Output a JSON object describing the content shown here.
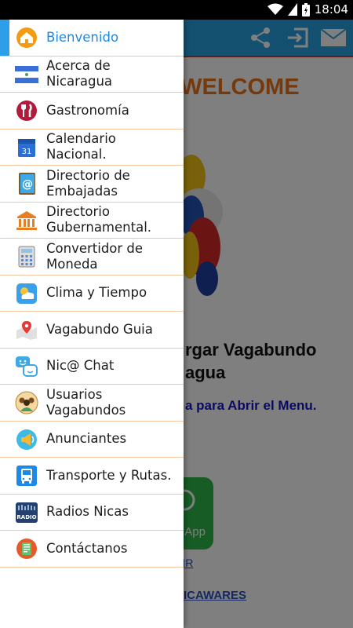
{
  "status_bar": {
    "time": "18:04"
  },
  "app": {
    "welcome_text": "/ WELCOME",
    "heading_line1": "rgar Vagabundo",
    "heading_line2": "agua",
    "menu_hint": "a para Abrir el Menu.",
    "whatsapp_label": "App",
    "share_link": "RTIR",
    "credit_prefix": "- ",
    "credit_link": "NICAWARES"
  },
  "colors": {
    "toolbar": "#29a3e0",
    "accent": "#e8731a",
    "selected": "#1e88e5",
    "divider": "#f3c7a0"
  },
  "drawer": {
    "items": [
      {
        "label": "Bienvenido",
        "icon": "home-icon",
        "selected": true
      },
      {
        "label": "Acerca de Nicaragua",
        "icon": "nicaragua-flag-icon",
        "selected": false
      },
      {
        "label": "Gastronomía",
        "icon": "fork-knife-icon",
        "selected": false
      },
      {
        "label": "Calendario Nacional.",
        "icon": "calendar-icon",
        "calendar_day": "31",
        "selected": false
      },
      {
        "label": "Directorio de Embajadas",
        "icon": "contacts-book-icon",
        "selected": false
      },
      {
        "label": "Directorio Gubernamental.",
        "icon": "government-building-icon",
        "selected": false
      },
      {
        "label": "Convertidor de Moneda",
        "icon": "calculator-icon",
        "selected": false
      },
      {
        "label": "Clima y Tiempo",
        "icon": "weather-icon",
        "selected": false
      },
      {
        "label": "Vagabundo Guia",
        "icon": "map-pin-icon",
        "selected": false
      },
      {
        "label": "Nic@ Chat",
        "icon": "chat-bubbles-icon",
        "selected": false
      },
      {
        "label": "Usuarios Vagabundos",
        "icon": "users-group-icon",
        "selected": false
      },
      {
        "label": "Anunciantes",
        "icon": "megaphone-icon",
        "selected": false
      },
      {
        "label": "Transporte y Rutas.",
        "icon": "bus-icon",
        "selected": false
      },
      {
        "label": "Radios Nicas",
        "icon": "radio-icon",
        "icon_text": "RADIO",
        "selected": false
      },
      {
        "label": "Contáctanos",
        "icon": "contact-icon",
        "selected": false
      }
    ]
  }
}
